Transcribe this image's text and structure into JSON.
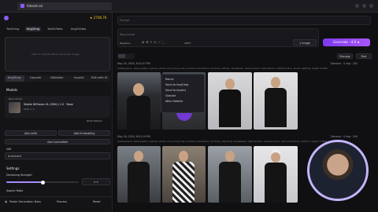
{
  "browser": {
    "tab_title": "fotoset.ai/",
    "favicon": "app-icon"
  },
  "left": {
    "balance": "★ 2706.76",
    "tabs": [
      "Text2Img",
      "Img2Img",
      "Text2Video",
      "Img2Video"
    ],
    "active_tab": 1,
    "prompt_placeholder": "Click or drop the file to upload an image",
    "subtabs": [
      "Img2Img",
      "Upscale",
      "ADetailer",
      "Inpaint",
      "Edit with AI"
    ],
    "models_title": "Models",
    "model_label": "Base Model",
    "model_name": "Stable Diffusion XL (SDXL) 1.0 · Base",
    "model_badge": "SDXL 1.0",
    "model_action": "DDXL Refiner",
    "add_lora": "Add LoRA",
    "add_embedding": "Add Embedding",
    "add_controlnet": "Add ControlNet",
    "vae_label": "VAE",
    "vae_value": "Automatic",
    "settings_title": "Settings",
    "denoise_label": "Denoising Strength",
    "denoise_value": "0.5",
    "aspect_label": "Aspect Ratio",
    "bottom": {
      "post": "Poster Generation Data",
      "process": "Process",
      "reset": "Reset"
    }
  },
  "right": {
    "prompt_placeholder": "Prompt",
    "negative_label": "Neg prompt",
    "toolbar": [
      "Negative",
      "AFFIT"
    ],
    "image_count": "1 image",
    "generate_label": "Generate · 4.0 ★",
    "manage_label": "Manage",
    "post_label": "Post",
    "batch1": {
      "date": "May 16, 2024, 8:01:47 PM",
      "prompt": "masterpiece, best quality, highres, photo of a young man, korean, handsome, full body, sitting, streetwear, black jacket, high fashion, detailed face, studio lighting, depth of field",
      "meta": "Denoise · 4 img · 200"
    },
    "batch2": {
      "date": "May 16, 2024, 8:01:19 PM",
      "prompt": "masterpiece, best quality, highres, photo of a young man, korean, handsome, full body, standing, streetwear, high fashion, detailed face, natural lighting, outdoor, depth of field",
      "meta": "Denoise · 4 img · 200"
    },
    "context_menu": [
      "Remix",
      "Send to Img2Img",
      "Send to Inpaint",
      "Upscale",
      "After Detailer"
    ]
  },
  "colors": {
    "accent": "#8b5cf6",
    "balance": "#facc15",
    "panel": "#141417"
  }
}
